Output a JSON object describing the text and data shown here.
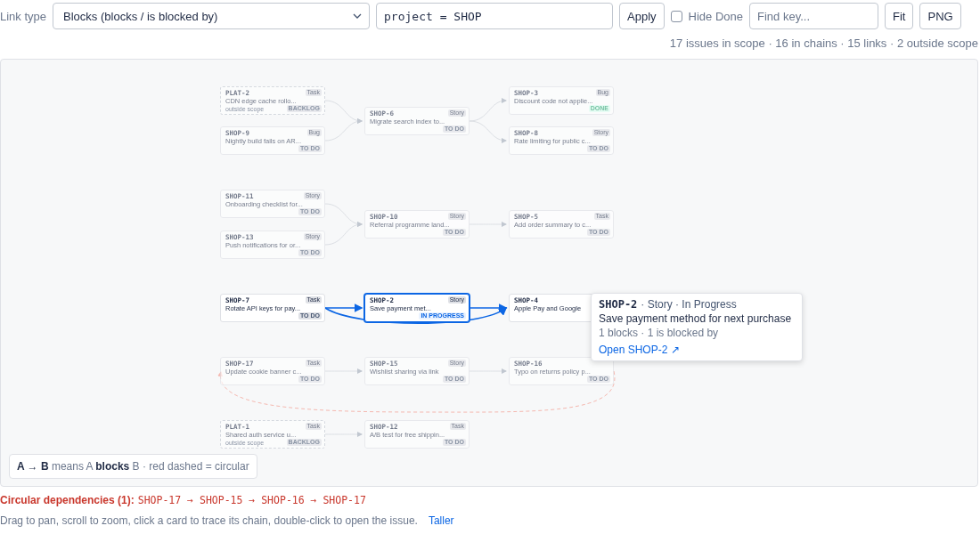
{
  "toolbar": {
    "link_type_label": "Link type",
    "link_type_value": "Blocks (blocks / is blocked by)",
    "query_value": "project = SHOP",
    "apply_button": "Apply",
    "hide_done": {
      "label": "Hide Done",
      "checked": false
    },
    "find_placeholder": "Find key...",
    "fit_button": "Fit",
    "png_button": "PNG"
  },
  "summary": "17 issues in scope · 16 in chains · 15 links · 2 outside scope",
  "cards": [
    {
      "key": "PLAT-2",
      "type": "Task",
      "title": "CDN edge cache rollo...",
      "status": "BACKLOG",
      "scope_note": "outside scope",
      "dimmed": true,
      "selected": false
    },
    {
      "key": "SHOP-9",
      "type": "Bug",
      "title": "Nightly build fails on AR...",
      "status": "TO DO",
      "dimmed": true,
      "selected": false
    },
    {
      "key": "SHOP-6",
      "type": "Story",
      "title": "Migrate search index to...",
      "status": "TO DO",
      "dimmed": true,
      "selected": false
    },
    {
      "key": "SHOP-3",
      "type": "Bug",
      "title": "Discount code not applie...",
      "status": "DONE",
      "dimmed": true,
      "selected": false
    },
    {
      "key": "SHOP-8",
      "type": "Story",
      "title": "Rate limiting for public c...",
      "status": "TO DO",
      "dimmed": true,
      "selected": false
    },
    {
      "key": "SHOP-11",
      "type": "Story",
      "title": "Onboarding checklist for...",
      "status": "TO DO",
      "dimmed": true,
      "selected": false
    },
    {
      "key": "SHOP-13",
      "type": "Story",
      "title": "Push notifications for or...",
      "status": "TO DO",
      "dimmed": true,
      "selected": false
    },
    {
      "key": "SHOP-10",
      "type": "Story",
      "title": "Referral programme land...",
      "status": "TO DO",
      "dimmed": true,
      "selected": false
    },
    {
      "key": "SHOP-5",
      "type": "Task",
      "title": "Add order summary to c...",
      "status": "TO DO",
      "dimmed": true,
      "selected": false
    },
    {
      "key": "SHOP-7",
      "type": "Task",
      "title": "Rotate API keys for pay...",
      "status": "TO DO",
      "dimmed": false,
      "selected": false
    },
    {
      "key": "SHOP-2",
      "type": "Story",
      "title": "Save payment met...",
      "status": "IN PROGRESS",
      "dimmed": false,
      "selected": true
    },
    {
      "key": "SHOP-4",
      "title": "Apple Pay and Google",
      "dimmed": false,
      "selected": false
    },
    {
      "key": "SHOP-17",
      "type": "Task",
      "title": "Update cookie banner c...",
      "status": "TO DO",
      "dimmed": true,
      "selected": false
    },
    {
      "key": "SHOP-15",
      "type": "Story",
      "title": "Wishlist sharing via link",
      "status": "TO DO",
      "dimmed": true,
      "selected": false
    },
    {
      "key": "SHOP-16",
      "title": "Typo on returns policy p...",
      "status": "TO DO",
      "dimmed": true,
      "selected": false
    },
    {
      "key": "PLAT-1",
      "type": "Task",
      "title": "Shared auth service u...",
      "status": "BACKLOG",
      "scope_note": "outside scope",
      "dimmed": true,
      "selected": false
    },
    {
      "key": "SHOP-12",
      "type": "Task",
      "title": "A/B test for free shippin...",
      "status": "TO DO",
      "dimmed": true,
      "selected": false
    }
  ],
  "tooltip": {
    "key": "SHOP-2",
    "meta": "· Story · In Progress",
    "title": "Save payment method for next purchase",
    "counts": "1 blocks · 1 is blocked by",
    "link": "Open SHOP-2 ↗"
  },
  "legend": "**A → B** means A **blocks** B · red dashed = circular",
  "circular": {
    "label": "Circular dependencies (1):",
    "chain": "SHOP-17 → SHOP-15 → SHOP-16 → SHOP-17"
  },
  "help": {
    "text": "Drag to pan, scroll to zoom, click a card to trace its chain, double-click to open the issue.",
    "link": "Taller"
  }
}
